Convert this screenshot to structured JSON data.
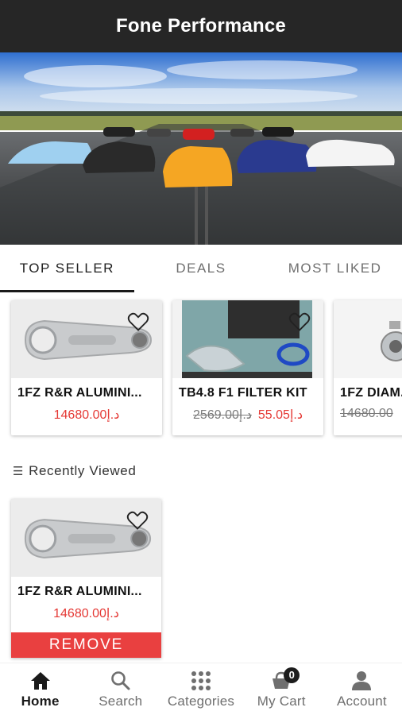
{
  "header": {
    "title": "Fone Performance"
  },
  "banner": {
    "description": ""
  },
  "tabs": [
    {
      "label": "TOP SELLER",
      "active": true
    },
    {
      "label": "DEALS",
      "active": false
    },
    {
      "label": "MOST LIKED",
      "active": false
    }
  ],
  "top_seller_products": [
    {
      "name": "1FZ R&R ALUMINI...",
      "price": "14680.00د.إ",
      "old_price": ""
    },
    {
      "name": "TB4.8 F1 FILTER KIT",
      "price": "55.05د.إ",
      "old_price": "2569.00د.إ"
    },
    {
      "name": "1FZ DIAM...",
      "price": "",
      "old_price": "14680.00"
    }
  ],
  "recently_viewed": {
    "title": "Recently Viewed",
    "items": [
      {
        "name": "1FZ R&R ALUMINI...",
        "price": "14680.00د.إ",
        "remove_label": "REMOVE"
      }
    ]
  },
  "bottom_nav": [
    {
      "label": "Home",
      "icon": "home-icon",
      "active": true
    },
    {
      "label": "Search",
      "icon": "search-icon",
      "active": false
    },
    {
      "label": "Categories",
      "icon": "grid-icon",
      "active": false
    },
    {
      "label": "My Cart",
      "icon": "cart-icon",
      "active": false,
      "badge": "0"
    },
    {
      "label": "Account",
      "icon": "account-icon",
      "active": false
    }
  ],
  "colors": {
    "header_bg": "#262626",
    "accent_red": "#e53935",
    "remove_bg": "#e94040"
  }
}
